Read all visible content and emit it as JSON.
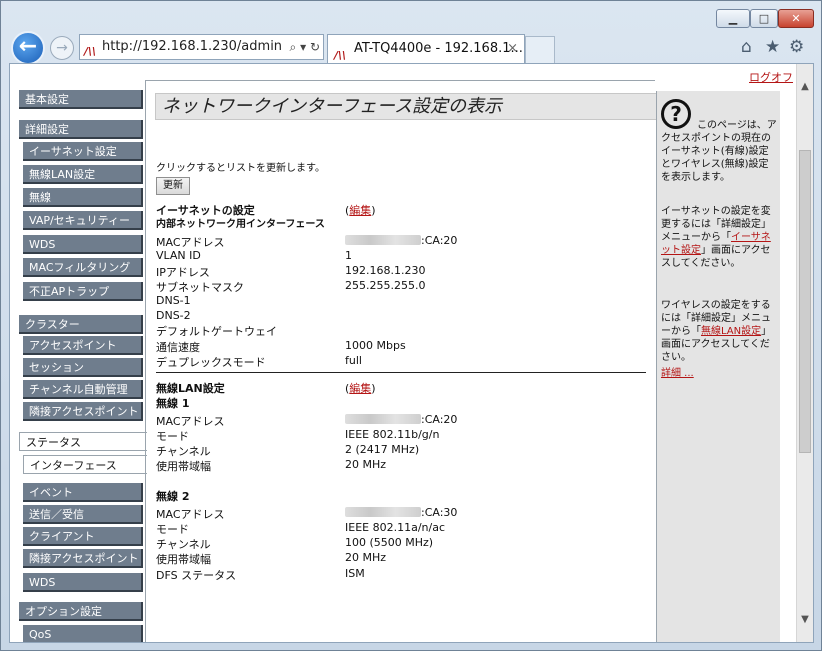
{
  "browser": {
    "url": "http://192.168.1.230/admin",
    "tab_title": "AT-TQ4400e - 192.168.1...",
    "tab_close": "×",
    "minimize": "▁",
    "maximize": "□",
    "close": "✕"
  },
  "logoff": "ログオフ",
  "nav": {
    "basic": "基本設定",
    "advanced": "詳細設定",
    "ethernet": "イーサネット設定",
    "wlan": "無線LAN設定",
    "wireless": "無線",
    "vap": "VAP/セキュリティー",
    "wds": "WDS",
    "mac_filter": "MACフィルタリング",
    "rogue_ap": "不正APトラップ",
    "cluster": "クラスター",
    "access_points": "アクセスポイント",
    "sessions": "セッション",
    "channel_mgmt": "チャンネル自動管理",
    "neighbor_ap": "隣接アクセスポイント",
    "status": "ステータス",
    "interfaces": "インターフェース",
    "events": "イベント",
    "tx_rx": "送信／受信",
    "clients": "クライアント",
    "neighbor_ap2": "隣接アクセスポイント",
    "wds2": "WDS",
    "options": "オプション設定",
    "qos": "QoS"
  },
  "page": {
    "title": "ネットワークインターフェース設定の表示",
    "refresh_text": "クリックするとリストを更新します。",
    "refresh_button": "更新",
    "edit_open": "(",
    "edit_label": "編集",
    "edit_close": ")"
  },
  "ethernet": {
    "heading": "イーサネットの設定",
    "subheading": "内部ネットワーク用インターフェース",
    "labels": [
      "MACアドレス",
      "VLAN ID",
      "IPアドレス",
      "サブネットマスク",
      "DNS-1",
      "DNS-2",
      "デフォルトゲートウェイ",
      "通信速度",
      "デュプレックスモード"
    ],
    "mac_suffix": ":CA:20",
    "vlan": "1",
    "ip": "192.168.1.230",
    "subnet": "255.255.255.0",
    "speed": "1000 Mbps",
    "duplex": "full"
  },
  "wlan": {
    "heading": "無線LAN設定",
    "radio1": {
      "heading": "無線 1",
      "labels": [
        "MACアドレス",
        "モード",
        "チャンネル",
        "使用帯域幅"
      ],
      "mac_suffix": ":CA:20",
      "mode": "IEEE 802.11b/g/n",
      "channel": "2 (2417 MHz)",
      "bandwidth": "20 MHz"
    },
    "radio2": {
      "heading": "無線 2",
      "labels": [
        "MACアドレス",
        "モード",
        "チャンネル",
        "使用帯域幅",
        "DFS ステータス"
      ],
      "mac_suffix": ":CA:30",
      "mode": "IEEE 802.11a/n/ac",
      "channel": "100 (5500 MHz)",
      "bandwidth": "20 MHz",
      "dfs": "ISM"
    }
  },
  "help": {
    "icon": "?",
    "p1": "このページは、アクセスポイントの現在のイーサネット(有線)設定とワイヤレス(無線)設定を表示します。",
    "p2_before": "イーサネットの設定を変更するには「詳細設定」メニューから「",
    "p2_link": "イーサネット設定",
    "p2_after": "」画面にアクセスしてください。",
    "p3_before": "ワイヤレスの設定をするには「詳細設定」メニューから「",
    "p3_link": "無線LAN設定",
    "p3_after": "」画面にアクセスしてください。",
    "more": "詳細 ..."
  }
}
